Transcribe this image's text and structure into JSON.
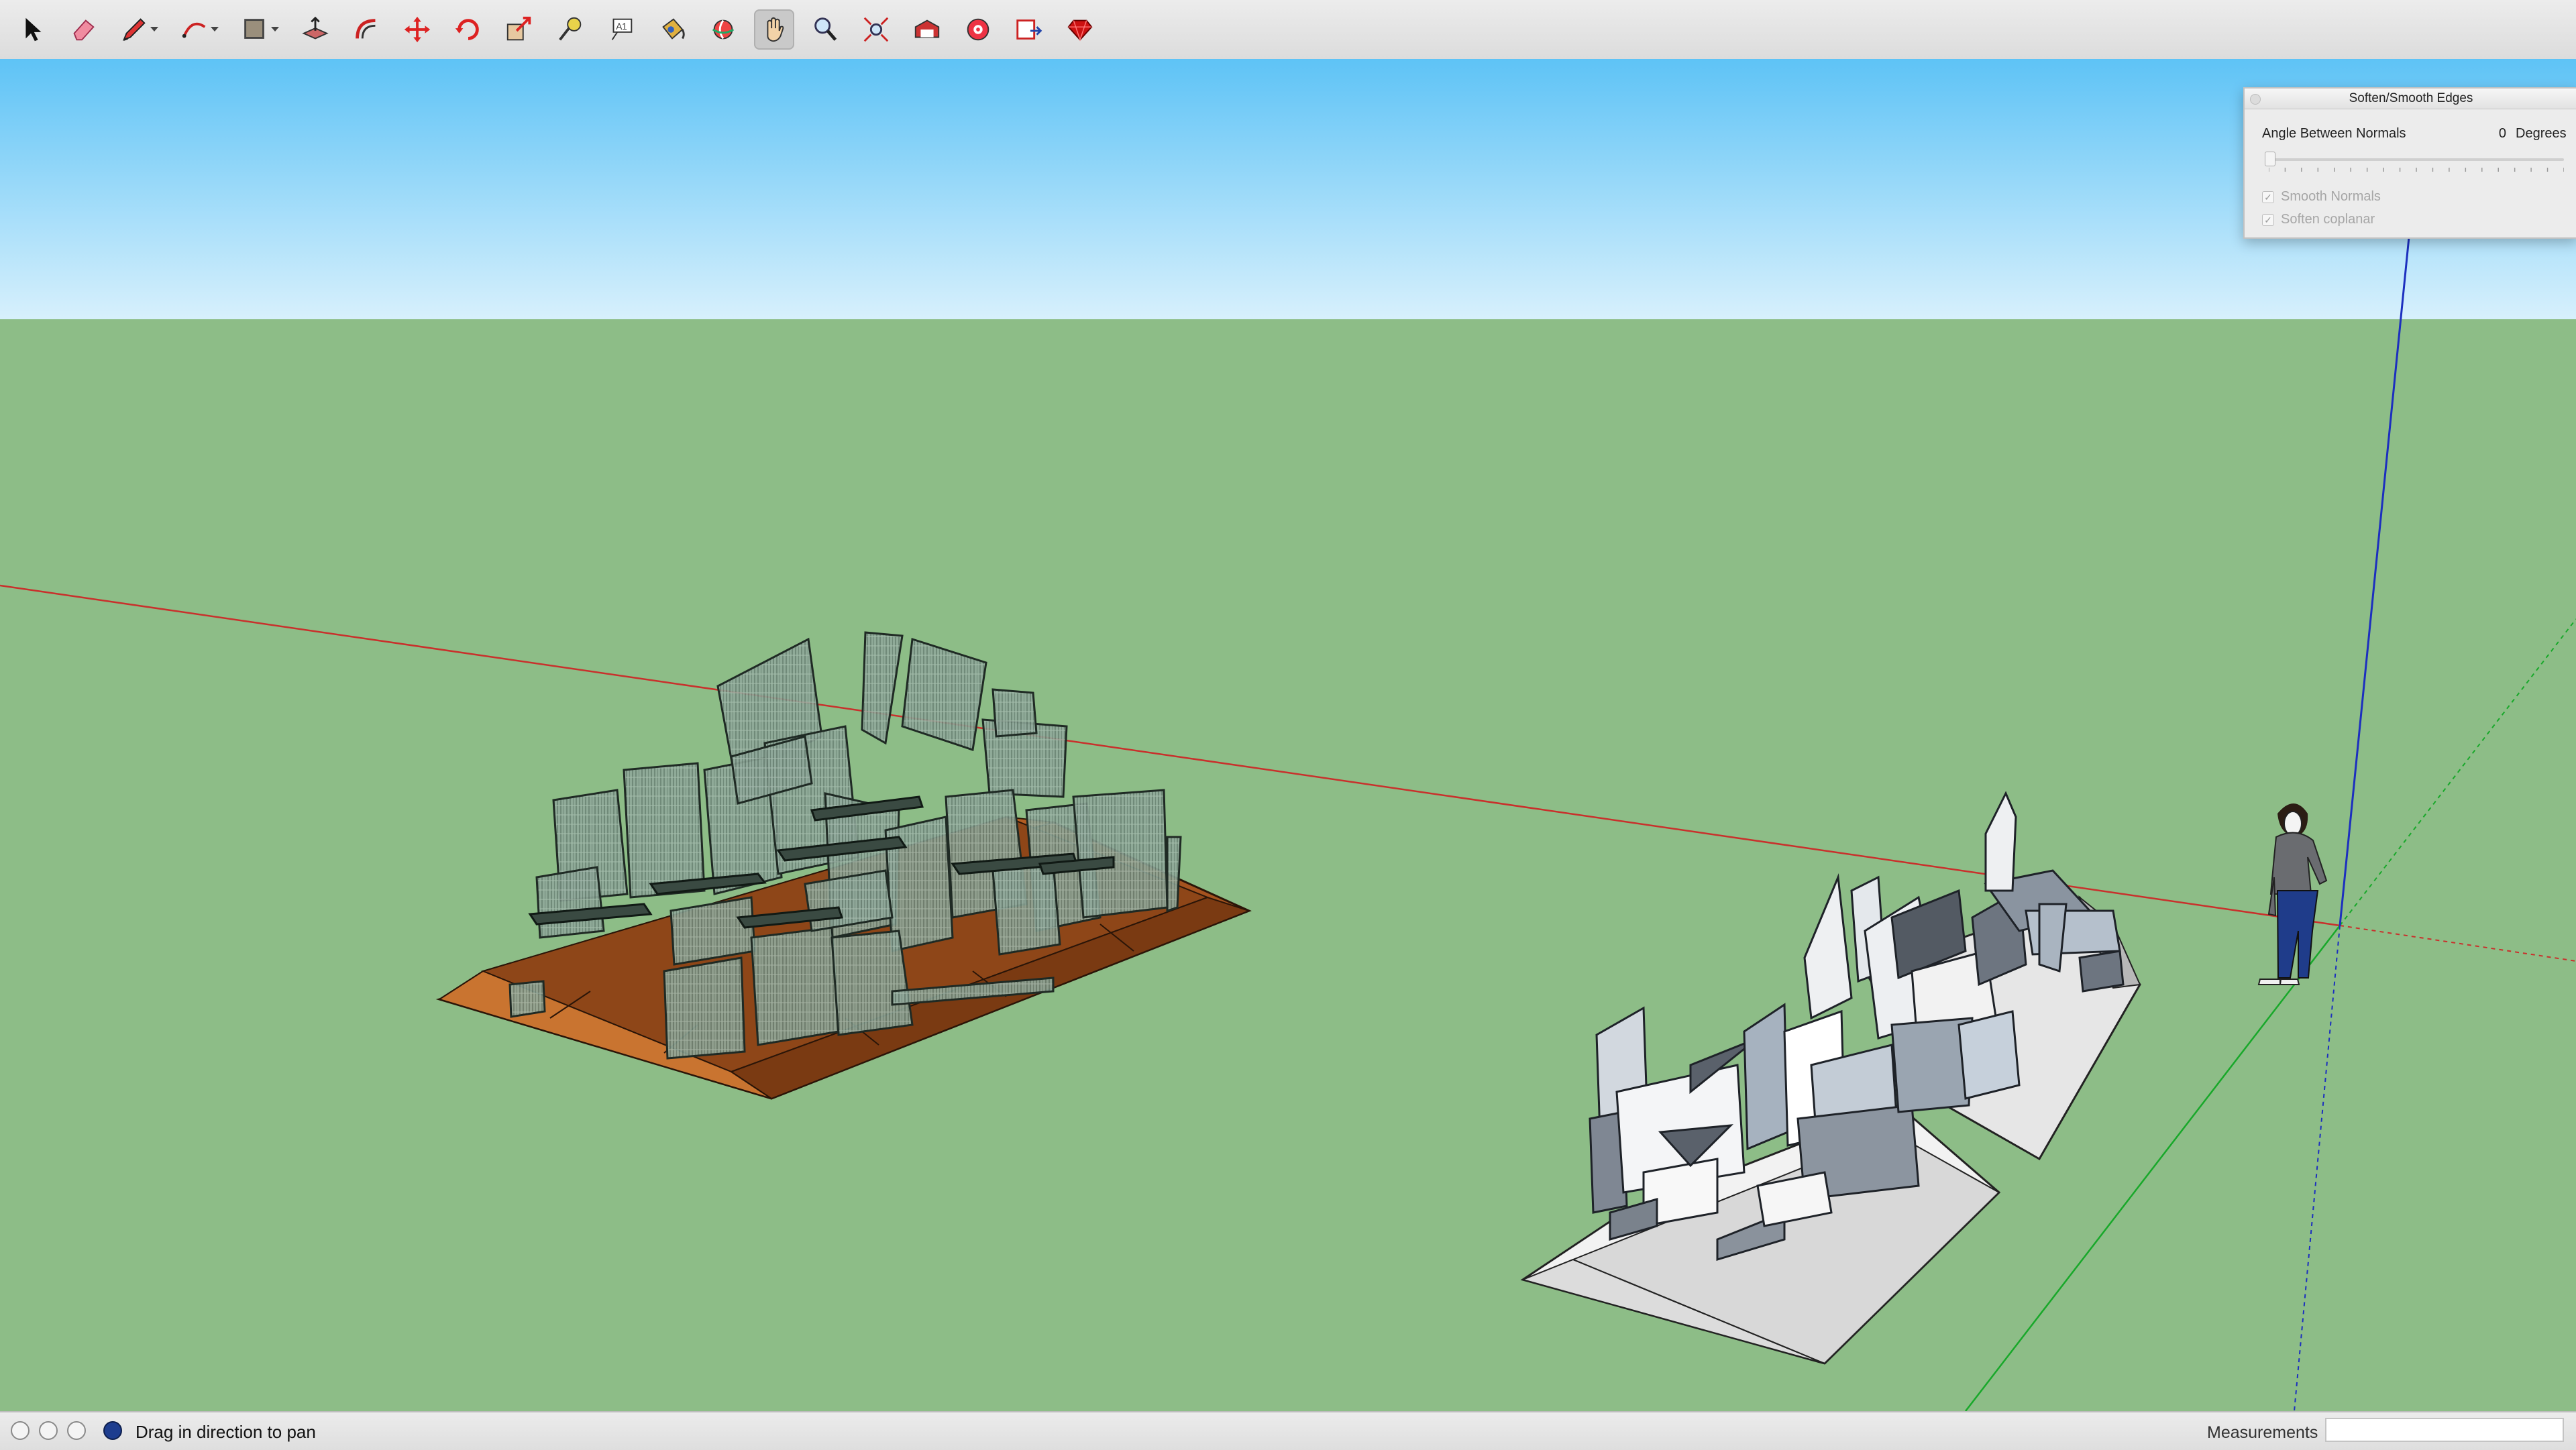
{
  "toolbar": {
    "tools": [
      {
        "id": "select",
        "icon": "arrow-cursor-icon"
      },
      {
        "id": "eraser",
        "icon": "eraser-icon"
      },
      {
        "id": "line",
        "icon": "pencil-icon",
        "dropdown": true
      },
      {
        "id": "arc",
        "icon": "arc-icon",
        "dropdown": true
      },
      {
        "id": "shapes",
        "icon": "rectangle-icon",
        "dropdown": true
      },
      {
        "id": "push-pull",
        "icon": "push-pull-icon"
      },
      {
        "id": "offset",
        "icon": "offset-icon"
      },
      {
        "id": "move",
        "icon": "move-icon"
      },
      {
        "id": "rotate",
        "icon": "rotate-icon"
      },
      {
        "id": "scale",
        "icon": "scale-icon"
      },
      {
        "id": "tape-measure",
        "icon": "tape-measure-icon"
      },
      {
        "id": "text",
        "icon": "text-icon"
      },
      {
        "id": "paint-bucket",
        "icon": "paint-bucket-icon"
      },
      {
        "id": "orbit",
        "icon": "orbit-icon"
      },
      {
        "id": "pan",
        "icon": "pan-hand-icon",
        "active": true
      },
      {
        "id": "zoom",
        "icon": "zoom-icon"
      },
      {
        "id": "zoom-extents",
        "icon": "zoom-extents-icon"
      },
      {
        "id": "warehouse",
        "icon": "warehouse-icon"
      },
      {
        "id": "extensions",
        "icon": "extension-warehouse-icon"
      },
      {
        "id": "layout",
        "icon": "send-to-layout-icon"
      },
      {
        "id": "ruby",
        "icon": "ruby-console-icon"
      }
    ]
  },
  "soften_panel": {
    "title": "Soften/Smooth Edges",
    "angle_label": "Angle Between Normals",
    "angle_value": "0",
    "angle_unit": "Degrees",
    "slider_level": 0,
    "smooth_normals_label": "Smooth Normals",
    "smooth_normals_checked": true,
    "soften_coplanar_label": "Soften coplanar",
    "soften_coplanar_checked": true
  },
  "status": {
    "text": "Drag in direction to pan",
    "measurements_label": "Measurements",
    "measurements_value": ""
  },
  "colors": {
    "sky_top": "#5ec3f6",
    "sky_bottom": "#d7f0fc",
    "ground": "#8dbd87",
    "red_axis": "#c9302c",
    "green_axis": "#18a82a",
    "blue_axis": "#1c2fbf",
    "wood": "#a5531f"
  }
}
